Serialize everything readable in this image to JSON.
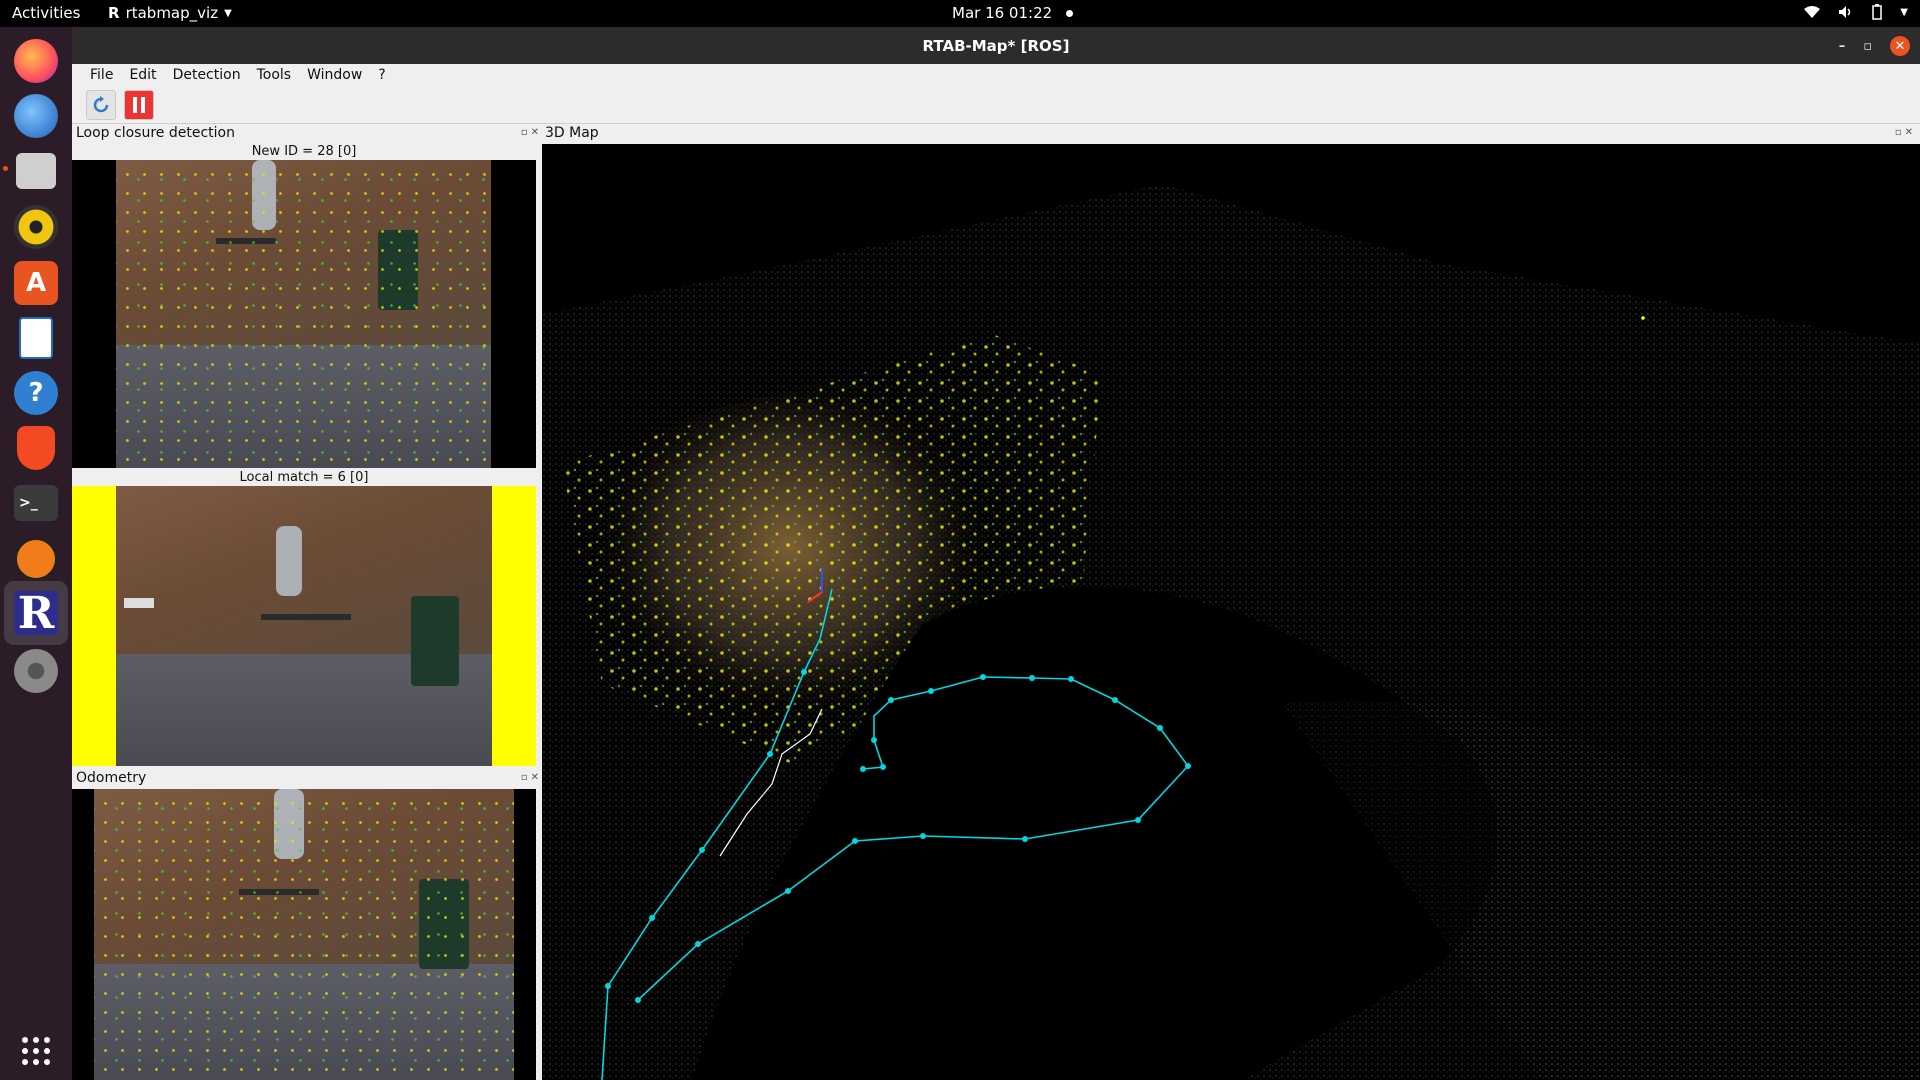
{
  "topbar": {
    "activities": "Activities",
    "app_name": "rtabmap_viz",
    "clock": "Mar 16  01:22"
  },
  "dock": {
    "items": [
      {
        "name": "firefox-icon",
        "color": "#ff7139"
      },
      {
        "name": "thunderbird-icon",
        "color": "#2f73c9"
      },
      {
        "name": "files-icon",
        "color": "#c4c4c4"
      },
      {
        "name": "rhythmbox-icon",
        "color": "#f2c511"
      },
      {
        "name": "software-center-icon",
        "color": "#e95420"
      },
      {
        "name": "writer-icon",
        "color": "#1e6fb8"
      },
      {
        "name": "help-icon",
        "color": "#2f80d1"
      },
      {
        "name": "brave-icon",
        "color": "#f34a24"
      },
      {
        "name": "terminal-icon",
        "color": "#3b3b3b"
      },
      {
        "name": "app-icon",
        "color": "#f07d1a"
      },
      {
        "name": "rtabmap-icon",
        "color": "#2d2d8c"
      },
      {
        "name": "settings-icon",
        "color": "#8a8a8a"
      },
      {
        "name": "show-apps-icon",
        "color": "#ffffff"
      }
    ]
  },
  "window": {
    "title": "RTAB-Map* [ROS]"
  },
  "menu": {
    "file": "File",
    "edit": "Edit",
    "detection": "Detection",
    "tools": "Tools",
    "window": "Window",
    "help": "?"
  },
  "panels": {
    "loop_title": "Loop closure detection",
    "new_id": "New ID = 28 [0]",
    "local_match": "Local match = 6 [0]",
    "odometry_title": "Odometry",
    "map_title": "3D Map"
  },
  "colors": {
    "trajectory": "#00d8e0",
    "highlight": "#ffff00",
    "accent": "#e95420"
  }
}
